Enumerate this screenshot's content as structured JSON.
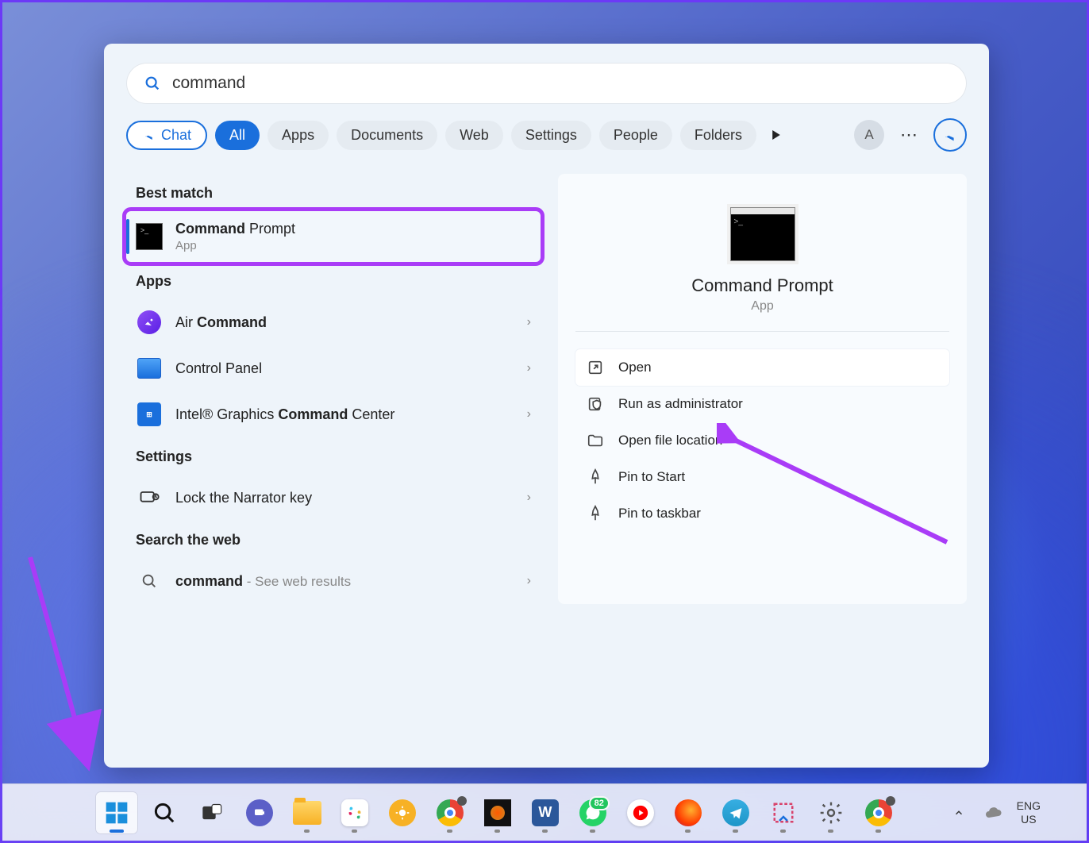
{
  "search": {
    "query": "command"
  },
  "filters": {
    "chat": "Chat",
    "tabs": [
      "All",
      "Apps",
      "Documents",
      "Web",
      "Settings",
      "People",
      "Folders"
    ],
    "active": "All"
  },
  "avatar_initial": "A",
  "left": {
    "best_match": "Best match",
    "best_result": {
      "title_bold": "Command",
      "title_rest": " Prompt",
      "sub": "App"
    },
    "apps_header": "Apps",
    "apps": [
      {
        "pre": "Air ",
        "bold": "Command",
        "post": ""
      },
      {
        "pre": "Control Panel",
        "bold": "",
        "post": ""
      },
      {
        "pre": "Intel® Graphics ",
        "bold": "Command",
        "post": " Center"
      }
    ],
    "settings_header": "Settings",
    "settings": [
      {
        "label": "Lock the Narrator key"
      }
    ],
    "web_header": "Search the web",
    "web": {
      "bold": "command",
      "hint": " - See web results"
    }
  },
  "preview": {
    "title": "Command Prompt",
    "sub": "App",
    "actions": [
      "Open",
      "Run as administrator",
      "Open file location",
      "Pin to Start",
      "Pin to taskbar"
    ]
  },
  "taskbar": {
    "items": [
      "start",
      "search",
      "taskview",
      "chat",
      "explorer",
      "slack",
      "weather",
      "chrome",
      "media",
      "word",
      "whatsapp",
      "youtube",
      "firefox",
      "telegram",
      "snip",
      "settings",
      "chrome2"
    ],
    "lang": {
      "top": "ENG",
      "bottom": "US"
    },
    "whatsapp_badge": "82"
  }
}
